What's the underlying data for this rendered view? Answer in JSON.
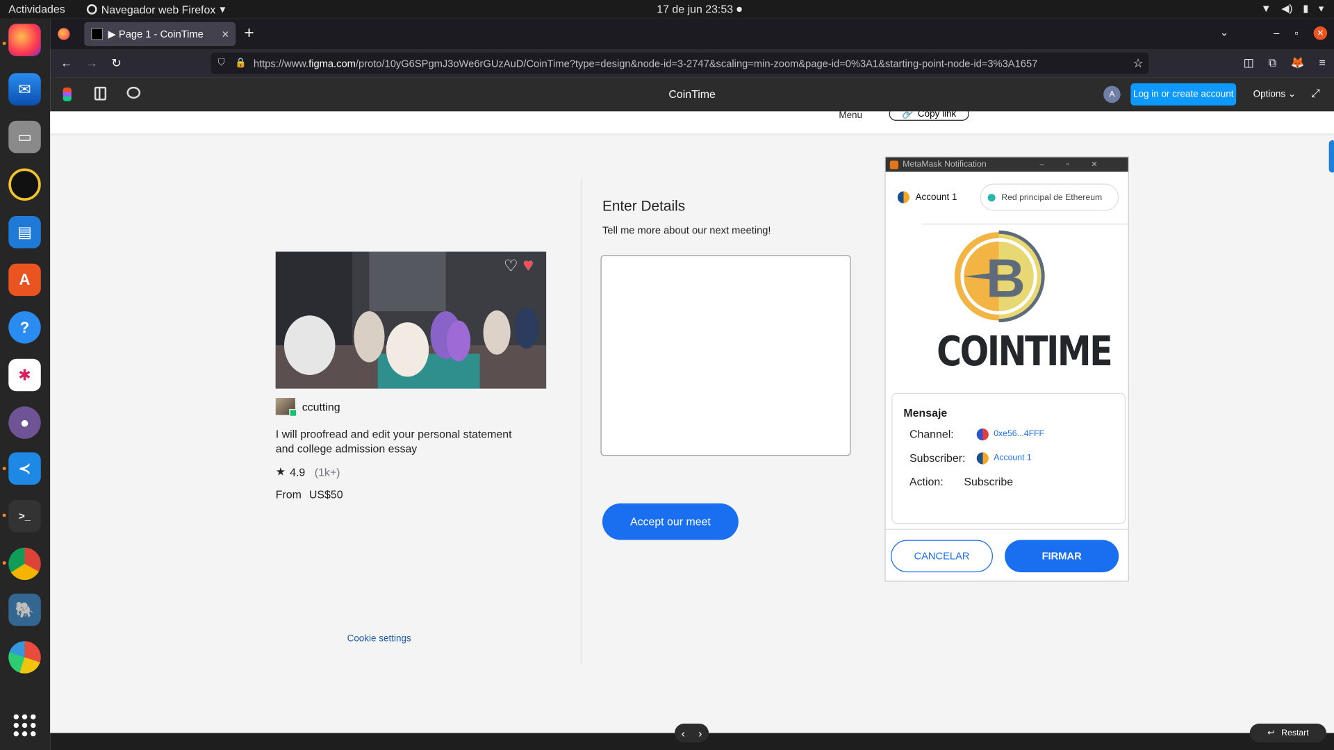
{
  "topbar": {
    "activities": "Actividades",
    "app_name": "Navegador web Firefox",
    "clock": "17 de jun  23:53"
  },
  "browser": {
    "tab_title": "▶ Page 1 - CoinTime",
    "url_prefix": "https://www.",
    "url_domain": "figma.com",
    "url_path": "/proto/10yG6SPgmJ3oWe6rGUzAuD/CoinTime?type=design&node-id=3-2747&scaling=min-zoom&page-id=0%3A1&starting-point-node-id=3%3A1657"
  },
  "figma": {
    "title": "CoinTime",
    "avatar_letter": "A",
    "login_label": "Log in or create account",
    "options_label": "Options ⌄",
    "restart_label": "Restart"
  },
  "page": {
    "menu_label": "Menu",
    "copy_link_label": "Copy link",
    "gig": {
      "seller": "ccutting",
      "title": "I will proofread and edit your personal statement and college admission essay",
      "rating": "4.9",
      "rating_count": "(1k+)",
      "price_prefix": "From",
      "price": "US$50"
    },
    "cookie_settings": "Cookie settings",
    "details": {
      "title": "Enter Details",
      "subtitle": "Tell me more about our next meeting!",
      "button": "Accept our meet"
    }
  },
  "metamask": {
    "window_title": "MetaMask Notification",
    "account": "Account 1",
    "network": "Red principal de Ethereum",
    "logo_text": "COINTIME",
    "message_heading": "Mensaje",
    "channel_label": "Channel:",
    "channel_value": "0xe56...4FFF",
    "subscriber_label": "Subscriber:",
    "subscriber_value": "Account 1",
    "action_label": "Action:",
    "action_value": "Subscribe",
    "cancel_label": "CANCELAR",
    "sign_label": "FIRMAR"
  },
  "colors": {
    "accent": "#1a6ff0",
    "figma_blue": "#0d99ff",
    "coin_gold": "#f2b443"
  }
}
